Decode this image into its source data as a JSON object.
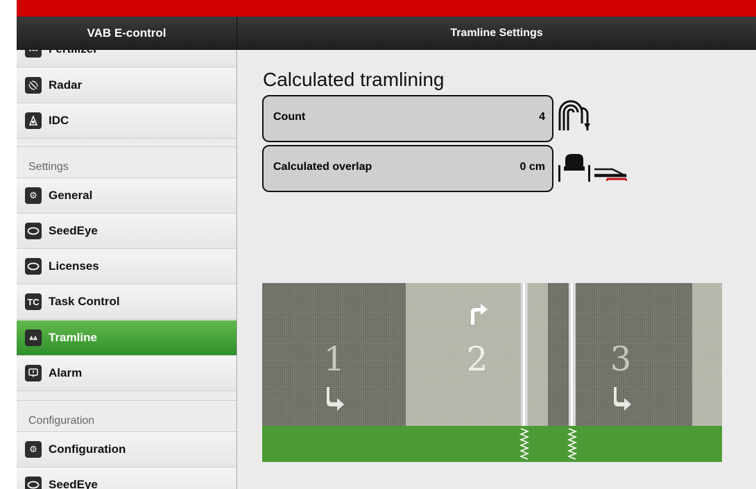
{
  "header": {
    "app_title": "VAB E-control",
    "page_title": "Tramline Settings"
  },
  "colors": {
    "topbar": "#d10000",
    "accent_green": "#4ca63a",
    "field_border": "#111111"
  },
  "sidebar": {
    "partial_top_label": "Fertilizer",
    "items": [
      {
        "label": "Radar",
        "icon": "radar-icon"
      },
      {
        "label": "IDC",
        "icon": "idc-icon"
      }
    ],
    "settings_section": "Settings",
    "settings_items": [
      {
        "label": "General",
        "icon": "gears-icon"
      },
      {
        "label": "SeedEye",
        "icon": "eye-icon"
      },
      {
        "label": "Licenses",
        "icon": "eye-icon"
      },
      {
        "label": "Task Control",
        "icon": "tc-icon",
        "icon_text": "TC"
      },
      {
        "label": "Tramline",
        "icon": "tramline-icon",
        "active": true
      },
      {
        "label": "Alarm",
        "icon": "alarm-icon"
      }
    ],
    "config_section": "Configuration",
    "config_items": [
      {
        "label": "Configuration",
        "icon": "gears-icon"
      },
      {
        "label": "SeedEye",
        "icon": "eye-icon"
      }
    ]
  },
  "main": {
    "section_title": "Calculated tramlining",
    "fields": [
      {
        "label": "Count",
        "value": "4",
        "icon": "turn-pattern-icon"
      },
      {
        "label": "Calculated overlap",
        "value": "0 cm",
        "icon": "tractor-overlap-icon"
      }
    ],
    "diagram": {
      "lanes": [
        "1",
        "2",
        "3"
      ]
    }
  }
}
